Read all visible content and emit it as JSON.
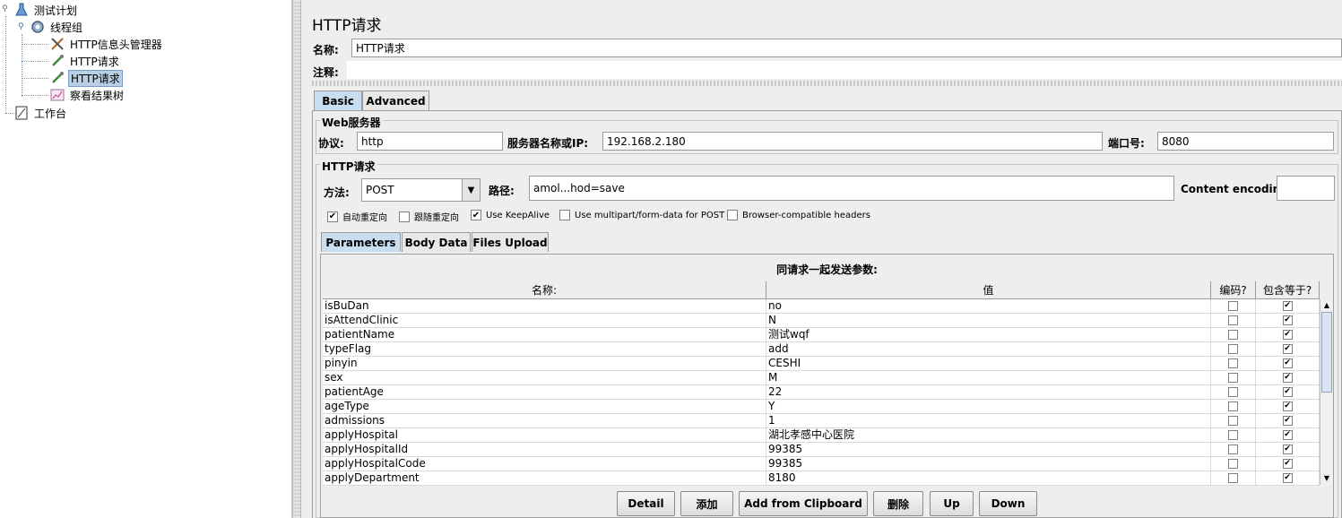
{
  "tree": {
    "root": "测试计划",
    "thread_group": "线程组",
    "children": [
      "HTTP信息头管理器",
      "HTTP请求",
      "HTTP请求",
      "察看结果树"
    ],
    "workbench": "工作台",
    "selected_index": 2
  },
  "panel": {
    "title": "HTTP请求",
    "name_label": "名称:",
    "name_value": "HTTP请求",
    "comment_label": "注释:",
    "comment_value": ""
  },
  "tabs": {
    "basic": "Basic",
    "advanced": "Advanced"
  },
  "web_server": {
    "group_title": "Web服务器",
    "protocol_label": "协议:",
    "protocol_value": "http",
    "server_label": "服务器名称或IP:",
    "server_value": "192.168.2.180",
    "port_label": "端口号:",
    "port_value": "8080"
  },
  "http_request": {
    "group_title": "HTTP请求",
    "method_label": "方法:",
    "method_value": "POST",
    "path_label": "路径:",
    "path_value": "amol...hod=save",
    "encoding_label": "Content encoding:",
    "encoding_value": ""
  },
  "options": [
    {
      "label": "自动重定向",
      "checked": true
    },
    {
      "label": "跟随重定向",
      "checked": false
    },
    {
      "label": "Use KeepAlive",
      "checked": true
    },
    {
      "label": "Use multipart/form-data for POST",
      "checked": false
    },
    {
      "label": "Browser-compatible headers",
      "checked": false
    }
  ],
  "sub_tabs": {
    "parameters": "Parameters",
    "body_data": "Body Data",
    "files_upload": "Files Upload"
  },
  "params": {
    "header": "同请求一起发送参数:",
    "columns": [
      "名称:",
      "值",
      "编码?",
      "包含等于?"
    ],
    "rows": [
      {
        "name": "isBuDan",
        "value": "no",
        "encode": false,
        "include_equals": true
      },
      {
        "name": "isAttendClinic",
        "value": "N",
        "encode": false,
        "include_equals": true
      },
      {
        "name": "patientName",
        "value": "测试wqf",
        "encode": false,
        "include_equals": true
      },
      {
        "name": "typeFlag",
        "value": "add",
        "encode": false,
        "include_equals": true
      },
      {
        "name": "pinyin",
        "value": "CESHI",
        "encode": false,
        "include_equals": true
      },
      {
        "name": "sex",
        "value": "M",
        "encode": false,
        "include_equals": true
      },
      {
        "name": "patientAge",
        "value": "22",
        "encode": false,
        "include_equals": true
      },
      {
        "name": "ageType",
        "value": "Y",
        "encode": false,
        "include_equals": true
      },
      {
        "name": "admissions",
        "value": "1",
        "encode": false,
        "include_equals": true
      },
      {
        "name": "applyHospital",
        "value": "湖北孝感中心医院",
        "encode": false,
        "include_equals": true
      },
      {
        "name": "applyHospitalId",
        "value": "99385",
        "encode": false,
        "include_equals": true
      },
      {
        "name": "applyHospitalCode",
        "value": "99385",
        "encode": false,
        "include_equals": true
      },
      {
        "name": "applyDepartment",
        "value": "8180",
        "encode": false,
        "include_equals": true
      }
    ]
  },
  "buttons": {
    "detail": "Detail",
    "add": "添加",
    "add_clipboard": "Add from Clipboard",
    "delete": "删除",
    "up": "Up",
    "down": "Down"
  }
}
